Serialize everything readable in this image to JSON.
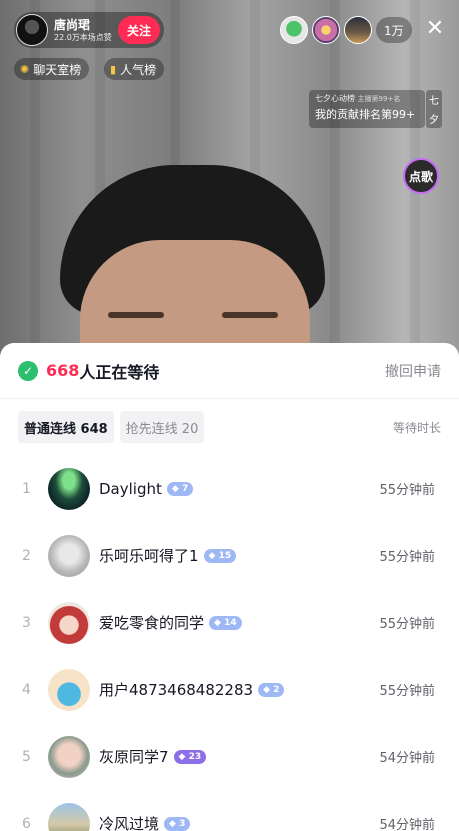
{
  "host": {
    "name": "唐尚珺",
    "subtitle": "22.0万本场点赞",
    "follow_label": "关注"
  },
  "viewers": {
    "count": "1万"
  },
  "chips": {
    "chat_rank": "聊天室榜",
    "popular_rank": "人气榜"
  },
  "rank_box": {
    "top": "七夕心动榜",
    "top_sub": "主播第99+名",
    "main": "我的贡献排名第99+",
    "side": [
      "七",
      "夕"
    ]
  },
  "song_button": "点歌",
  "queue": {
    "count": "668",
    "count_suffix": "人正在等待",
    "withdraw": "撤回申请",
    "tab_normal": "普通连线 648",
    "tab_priority": "抢先连线 20",
    "wait_header": "等待时长",
    "rows": [
      {
        "rank": "1",
        "name": "Daylight",
        "badge": "7",
        "time": "55分钟前"
      },
      {
        "rank": "2",
        "name": "乐呵乐呵得了1",
        "badge": "15",
        "time": "55分钟前"
      },
      {
        "rank": "3",
        "name": "爱吃零食的同学",
        "badge": "14",
        "time": "55分钟前"
      },
      {
        "rank": "4",
        "name": "用户4873468482283",
        "badge": "2",
        "time": "55分钟前"
      },
      {
        "rank": "5",
        "name": "灰原同学7",
        "badge": "23",
        "time": "54分钟前"
      },
      {
        "rank": "6",
        "name": "冷风过境",
        "badge": "3",
        "time": "54分钟前"
      }
    ]
  },
  "colors": {
    "accent": "#fe2c55",
    "success": "#2cbf6f"
  }
}
